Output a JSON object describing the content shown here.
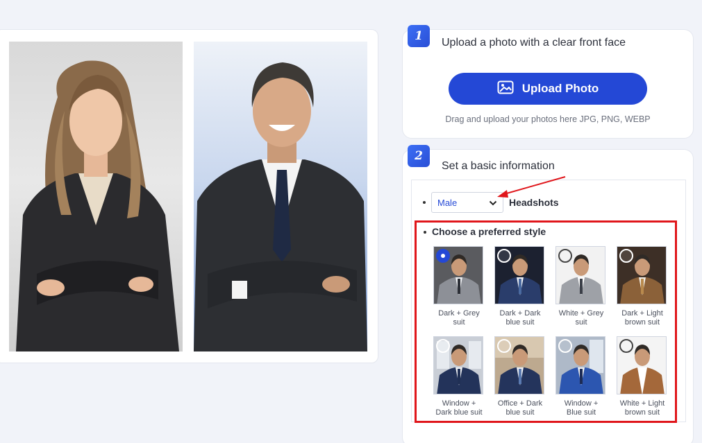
{
  "step1": {
    "number": "1",
    "title": "Upload a photo with a clear front face",
    "upload_label": "Upload Photo",
    "upload_icon": "image-icon",
    "hint": "Drag and upload your photos here JPG, PNG, WEBP"
  },
  "step2": {
    "number": "2",
    "title": "Set a basic information",
    "gender_value": "Male",
    "headshots_label": "Headshots",
    "style_title": "Choose a preferred style",
    "styles": [
      {
        "line1": "Dark + Grey",
        "line2": "suit",
        "checked": true
      },
      {
        "line1": "Dark + Dark",
        "line2": "blue suit",
        "checked": false
      },
      {
        "line1": "White + Grey",
        "line2": "suit",
        "checked": false
      },
      {
        "line1": "Dark + Light",
        "line2": "brown suit",
        "checked": false
      },
      {
        "line1": "Window +",
        "line2": "Dark blue suit",
        "checked": false
      },
      {
        "line1": "Office + Dark",
        "line2": "blue suit",
        "checked": false
      },
      {
        "line1": "Window +",
        "line2": "Blue suit",
        "checked": false
      },
      {
        "line1": "White + Light",
        "line2": "brown suit",
        "checked": false
      }
    ]
  },
  "colors": {
    "accent": "#2448d6",
    "highlight_box": "#e0161b"
  }
}
